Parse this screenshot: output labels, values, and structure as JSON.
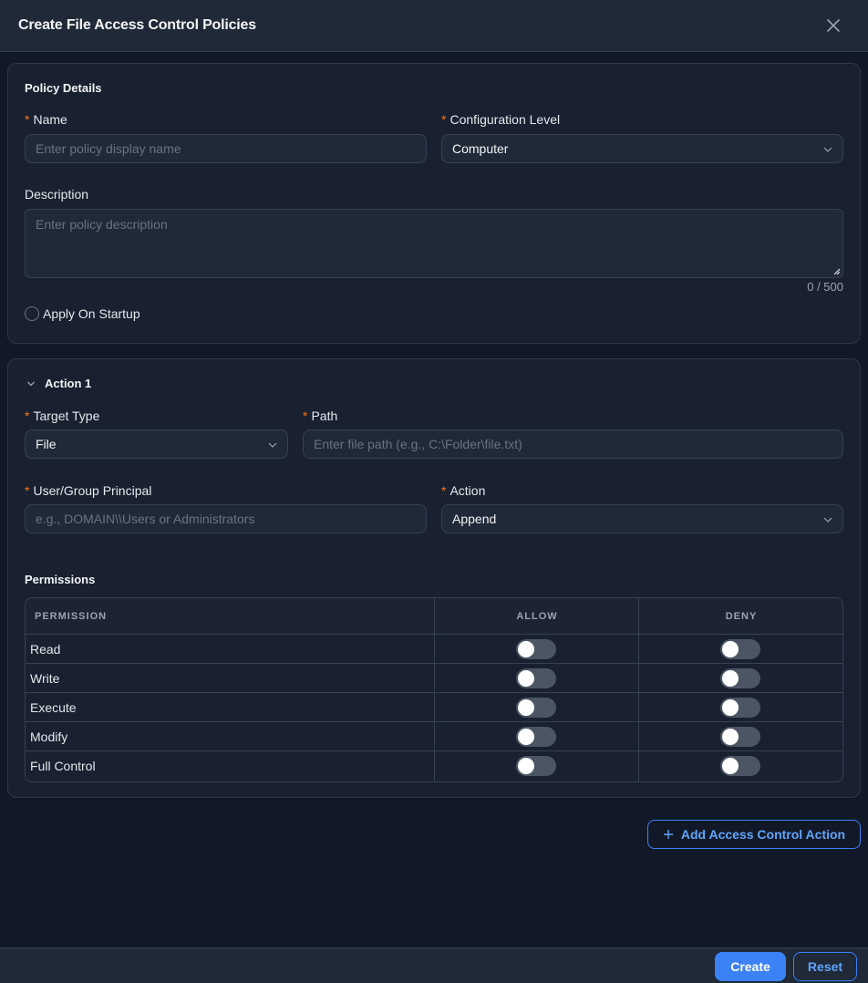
{
  "dialog": {
    "title": "Create File Access Control Policies"
  },
  "policy_details": {
    "section_title": "Policy Details",
    "name_label": "Name",
    "name_placeholder": "Enter policy display name",
    "config_level_label": "Configuration Level",
    "config_level_value": "Computer",
    "description_label": "Description",
    "description_placeholder": "Enter policy description",
    "description_counter": "0 / 500",
    "apply_on_startup_label": "Apply On Startup"
  },
  "action": {
    "section_title": "Action 1",
    "target_type_label": "Target Type",
    "target_type_value": "File",
    "path_label": "Path",
    "path_placeholder": "Enter file path (e.g., C:\\Folder\\file.txt)",
    "principal_label": "User/Group Principal",
    "principal_placeholder": "e.g., DOMAIN\\\\Users or Administrators",
    "action_label": "Action",
    "action_value": "Append",
    "permissions_title": "Permissions",
    "table_headers": {
      "permission": "PERMISSION",
      "allow": "ALLOW",
      "deny": "DENY"
    },
    "permissions": [
      {
        "name": "Read",
        "allow": false,
        "deny": false
      },
      {
        "name": "Write",
        "allow": false,
        "deny": false
      },
      {
        "name": "Execute",
        "allow": false,
        "deny": false
      },
      {
        "name": "Modify",
        "allow": false,
        "deny": false
      },
      {
        "name": "Full Control",
        "allow": false,
        "deny": false
      }
    ]
  },
  "buttons": {
    "add_action": "Add Access Control Action",
    "create": "Create",
    "reset": "Reset"
  },
  "required_marker": "*",
  "colors": {
    "accent": "#3b82f6",
    "required": "#f97316",
    "background": "#111827"
  }
}
